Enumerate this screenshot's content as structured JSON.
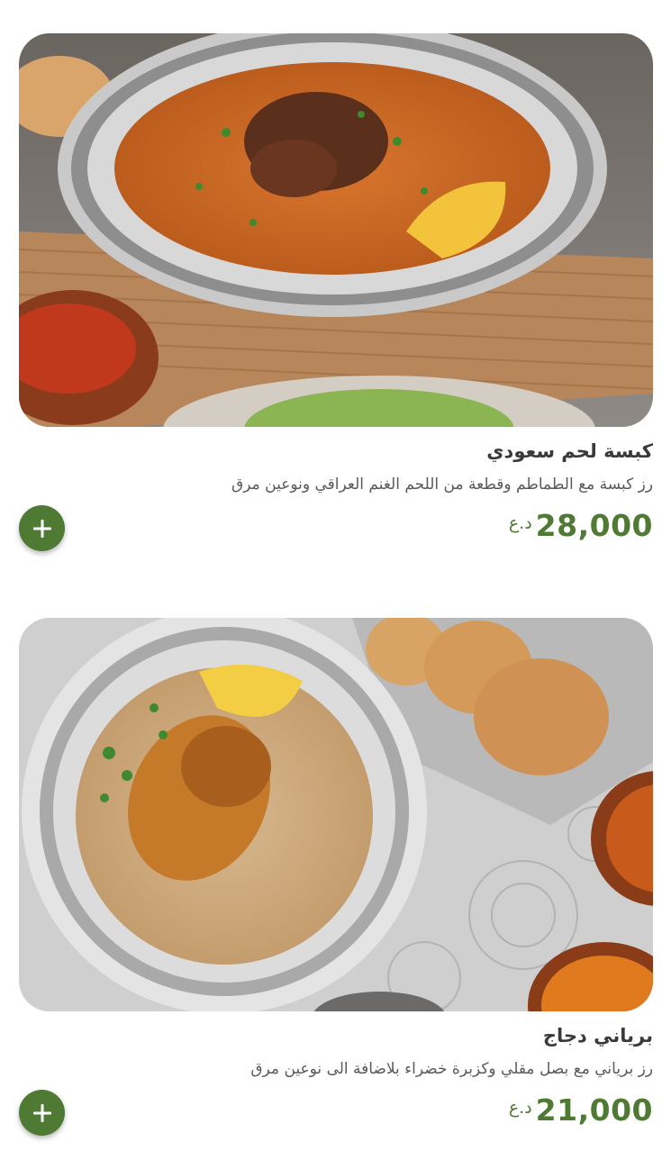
{
  "colors": {
    "accent": "#4f7a34",
    "title_text": "#3a3a3a",
    "description_text": "#5a5a5a",
    "background": "#ffffff"
  },
  "items": [
    {
      "title": "كبسة لحم سعودي",
      "description": "رز كبسة مع الطماطم وقطعة من اللحم الغنم العراقي ونوعين مرق",
      "price": "28,000",
      "currency": "د.ع",
      "image_icon": "kabsa-meat-dish-image",
      "add_icon": "plus-icon"
    },
    {
      "title": "برياني دجاج",
      "description": "رز برياني مع بصل مقلي وكزبرة خضراء بلاضافة الى نوعين مرق",
      "price": "21,000",
      "currency": "د.ع",
      "image_icon": "chicken-biryani-dish-image",
      "add_icon": "plus-icon"
    }
  ]
}
